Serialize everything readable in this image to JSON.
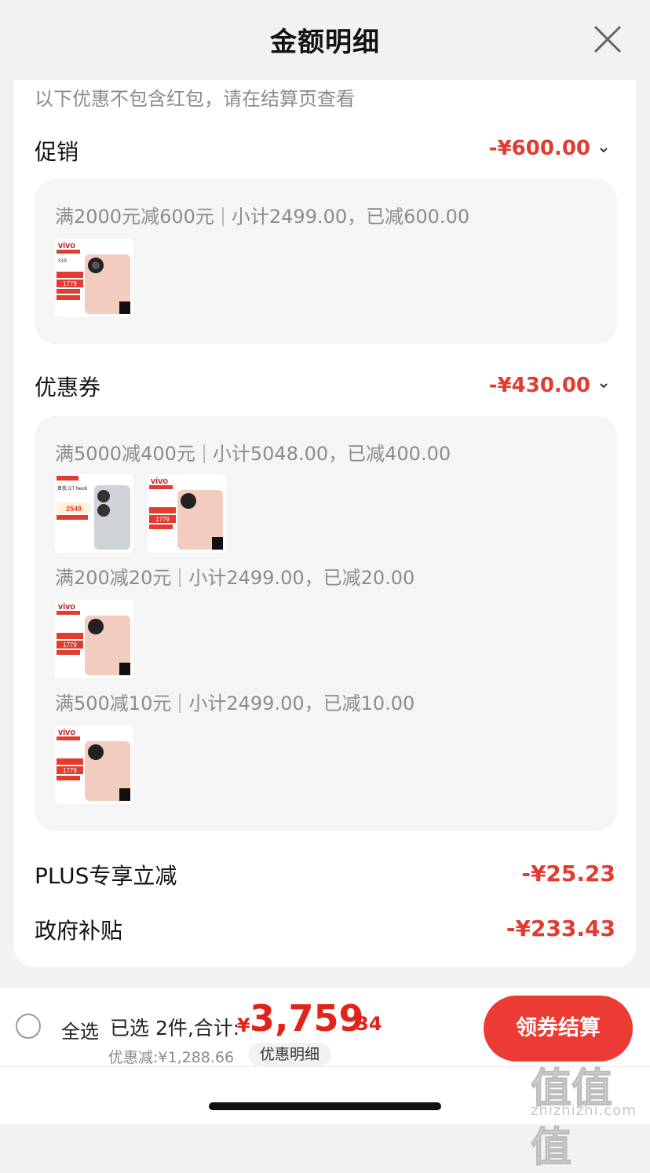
{
  "header": {
    "title": "金额明细",
    "close_icon": "close-icon"
  },
  "note": "以下优惠不包含红包，请在结算页查看",
  "promo": {
    "label": "促销",
    "amount": "-¥600.00",
    "rules": [
      {
        "condition": "满2000元减600元",
        "detail": "小计2499.00，已减600.00",
        "products": [
          {
            "brand": "vivo",
            "model": "S19",
            "price": "1779",
            "badge": "价保 11.11"
          }
        ]
      }
    ]
  },
  "coupon": {
    "label": "优惠券",
    "amount": "-¥430.00",
    "rules": [
      {
        "condition": "满5000减400元",
        "detail": "小计5048.00，已减400.00",
        "products": [
          {
            "brand": "真我",
            "model": "真我 GT Neo6",
            "price": "2549"
          },
          {
            "brand": "vivo",
            "model": "S19",
            "price": "1779",
            "badge": "价保 11.11"
          }
        ]
      },
      {
        "condition": "满200减20元",
        "detail": "小计2499.00，已减20.00",
        "products": [
          {
            "brand": "vivo",
            "model": "S19",
            "price": "1779",
            "badge": "价保 11.11"
          }
        ]
      },
      {
        "condition": "满500减10元",
        "detail": "小计2499.00，已减10.00",
        "products": [
          {
            "brand": "vivo",
            "model": "S19",
            "price": "1779",
            "badge": "价保 11.11"
          }
        ]
      }
    ]
  },
  "plus": {
    "label": "PLUS专享立减",
    "amount": "-¥25.23"
  },
  "gov": {
    "label": "政府补贴",
    "amount": "-¥233.43"
  },
  "bottom": {
    "select_all": "全选",
    "selected_text": "已选 2件,合计:",
    "currency": "¥",
    "total_int": "3,759",
    "total_dec": ".34",
    "discount_text": "优惠减:¥1,288.66",
    "detail_button": "优惠明细",
    "checkout_button": "领券结算"
  },
  "watermark": {
    "glyphs": "值值值",
    "url": "zhizhizhi.com"
  },
  "colors": {
    "accent": "#e23b2f",
    "checkout": "#ec3a35",
    "panel": "#f5f5f5"
  }
}
